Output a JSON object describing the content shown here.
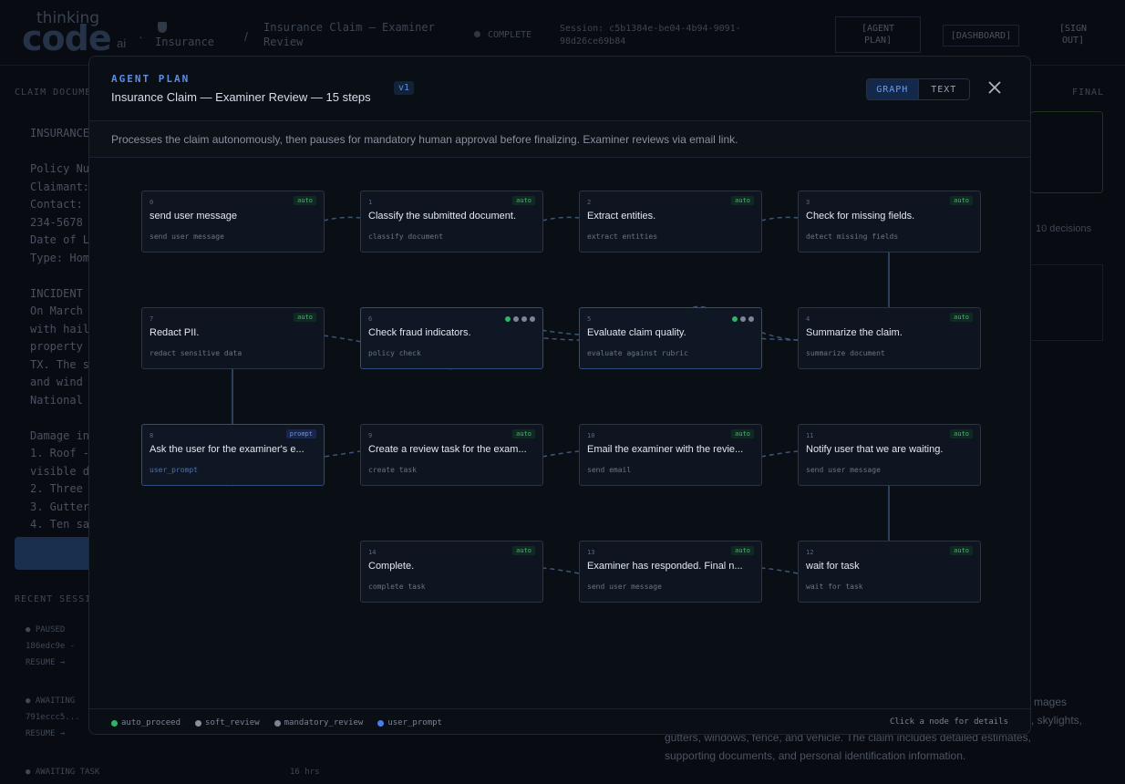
{
  "background": {
    "logo": {
      "top": "thinking",
      "code": "code",
      "ai": "ai"
    },
    "breadcrumb": {
      "item1": "Insurance",
      "item2_line1": "Insurance Claim — Examiner",
      "item2_line2": "Review"
    },
    "status": "COMPLETE",
    "session_line1": "Session: c5b1384e-be04-4b94-9091-",
    "session_line2": "98d26ce69b84",
    "buttons": {
      "agent_plan_1": "[AGENT",
      "agent_plan_2": "PLAN]",
      "dashboard": "[DASHBOARD]",
      "signout_1": "[SIGN",
      "signout_2": "OUT]"
    },
    "left_label": "CLAIM DOCUME",
    "right_label": "FINAL",
    "decisions": "10 decisions",
    "doc_lines": [
      "INSURANCE",
      "Policy Nu",
      "Claimant:",
      "Contact:",
      "234-5678",
      "Date of L",
      "Type: Hom",
      "INCIDENT",
      "On March",
      "with hail",
      "property",
      "TX. The s",
      "and wind",
      "National",
      "Damage in",
      "1. Roof -",
      "visible d",
      "2. Three",
      "3. Gutter",
      "4. Ten sa"
    ],
    "recent": "RECENT SESSI",
    "sessions": [
      {
        "status": "● PAUSED",
        "id": "186edc9e -",
        "action": "RESUME →"
      },
      {
        "status": "● AWAITING",
        "id": "791eccc5...",
        "action": "RESUME →"
      },
      {
        "status": "● AWAITING TASK",
        "id": "",
        "action": ""
      }
    ],
    "ago": "16 hrs",
    "right_text": [
      "mages",
      ", skylights,",
      "gutters, windows, fence, and vehicle. The claim includes detailed estimates,",
      "supporting documents, and personal identification information."
    ]
  },
  "modal": {
    "eyebrow": "AGENT PLAN",
    "title": "Insurance Claim — Examiner Review — 15 steps",
    "version": "v1",
    "views": {
      "graph": "GRAPH",
      "text": "TEXT"
    },
    "description": "Processes the claim autonomously, then pauses for mandatory human approval before finalizing. Examiner reviews via email link.",
    "nodes": [
      {
        "num": "0",
        "title": "send user message",
        "sub": "send user message",
        "badge": "auto"
      },
      {
        "num": "1",
        "title": "Classify the submitted document.",
        "sub": "classify document",
        "badge": "auto"
      },
      {
        "num": "2",
        "title": "Extract entities.",
        "sub": "extract entities",
        "badge": "auto"
      },
      {
        "num": "3",
        "title": "Check for missing fields.",
        "sub": "detect missing fields",
        "badge": "auto"
      },
      {
        "num": "7",
        "title": "Redact PII.",
        "sub": "redact sensitive data",
        "badge": "auto"
      },
      {
        "num": "6",
        "title": "Check fraud indicators.",
        "sub": "policy check",
        "badge": ""
      },
      {
        "num": "5",
        "title": "Evaluate claim quality.",
        "sub": "evaluate against rubric",
        "badge": ""
      },
      {
        "num": "4",
        "title": "Summarize the claim.",
        "sub": "summarize document",
        "badge": "auto"
      },
      {
        "num": "8",
        "title": "Ask the user for the examiner's e...",
        "sub": "user_prompt",
        "badge": "prompt"
      },
      {
        "num": "9",
        "title": "Create a review task for the exam...",
        "sub": "create task",
        "badge": "auto"
      },
      {
        "num": "10",
        "title": "Email the examiner with the revie...",
        "sub": "send email",
        "badge": "auto"
      },
      {
        "num": "11",
        "title": "Notify user that we are waiting.",
        "sub": "send user message",
        "badge": "auto"
      },
      {
        "num": "14",
        "title": "Complete.",
        "sub": "complete task",
        "badge": "auto"
      },
      {
        "num": "13",
        "title": "Examiner has responded. Final n...",
        "sub": "send user message",
        "badge": "auto"
      },
      {
        "num": "12",
        "title": "wait for task",
        "sub": "wait for task",
        "badge": "auto"
      }
    ],
    "legend": [
      {
        "label": "auto_proceed",
        "color": "#2eb368"
      },
      {
        "label": "soft_review",
        "color": "#8a8f98"
      },
      {
        "label": "mandatory_review",
        "color": "#7d8594"
      },
      {
        "label": "user_prompt",
        "color": "#4a7ee6"
      }
    ],
    "hint": "Click a node for details"
  }
}
